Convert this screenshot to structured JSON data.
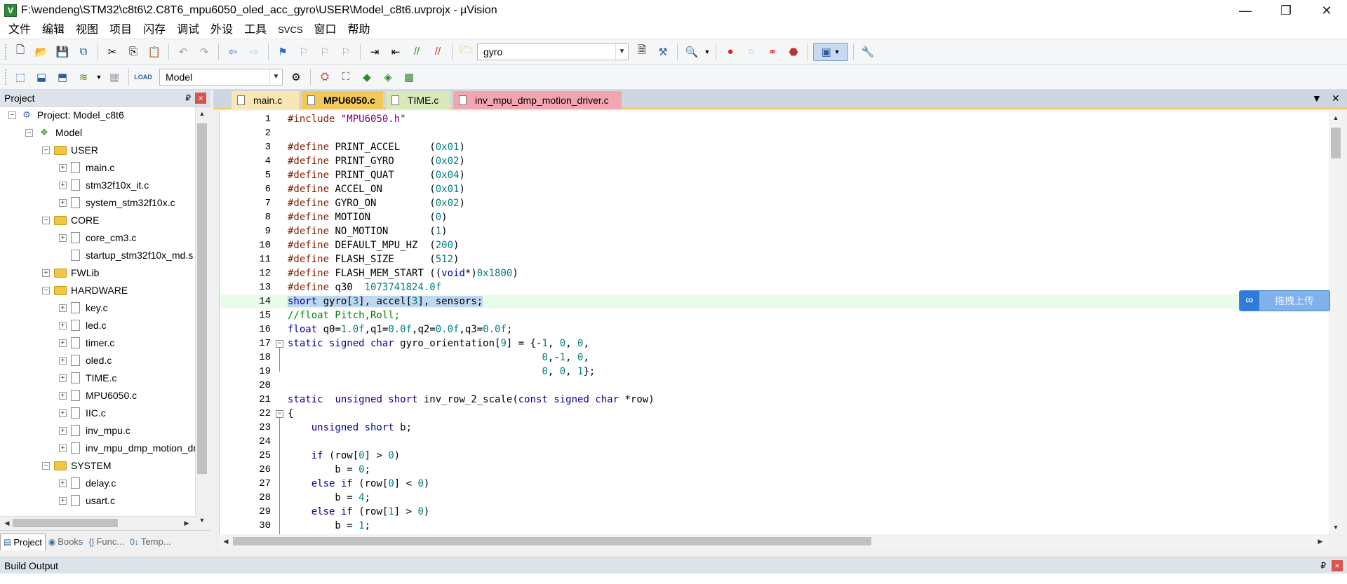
{
  "window": {
    "title": "F:\\wendeng\\STM32\\c8t6\\2.C8T6_mpu6050_oled_acc_gyro\\USER\\Model_c8t6.uvprojx - µVision",
    "app_icon_letter": "V",
    "minimize": "—",
    "maximize": "❐",
    "close": "✕"
  },
  "menu": [
    "文件",
    "编辑",
    "视图",
    "项目",
    "闪存",
    "调试",
    "外设",
    "工具",
    "SVCS",
    "窗口",
    "帮助"
  ],
  "toolbar": {
    "search_value": "gyro",
    "target_value": "Model"
  },
  "project_panel": {
    "title": "Project",
    "pin": "₽",
    "close": "×",
    "tree": [
      {
        "label": "Project: Model_c8t6",
        "level": 0,
        "kind": "project",
        "expander": "−"
      },
      {
        "label": "Model",
        "level": 1,
        "kind": "target",
        "expander": "−"
      },
      {
        "label": "USER",
        "level": 2,
        "kind": "folder",
        "expander": "−"
      },
      {
        "label": "main.c",
        "level": 3,
        "kind": "file",
        "expander": "+"
      },
      {
        "label": "stm32f10x_it.c",
        "level": 3,
        "kind": "file",
        "expander": "+"
      },
      {
        "label": "system_stm32f10x.c",
        "level": 3,
        "kind": "file",
        "expander": "+"
      },
      {
        "label": "CORE",
        "level": 2,
        "kind": "folder",
        "expander": "−"
      },
      {
        "label": "core_cm3.c",
        "level": 3,
        "kind": "file",
        "expander": "+"
      },
      {
        "label": "startup_stm32f10x_md.s",
        "level": 3,
        "kind": "file",
        "expander": ""
      },
      {
        "label": "FWLib",
        "level": 2,
        "kind": "folder",
        "expander": "+"
      },
      {
        "label": "HARDWARE",
        "level": 2,
        "kind": "folder",
        "expander": "−"
      },
      {
        "label": "key.c",
        "level": 3,
        "kind": "file",
        "expander": "+"
      },
      {
        "label": "led.c",
        "level": 3,
        "kind": "file",
        "expander": "+"
      },
      {
        "label": "timer.c",
        "level": 3,
        "kind": "file",
        "expander": "+"
      },
      {
        "label": "oled.c",
        "level": 3,
        "kind": "file",
        "expander": "+"
      },
      {
        "label": "TIME.c",
        "level": 3,
        "kind": "file",
        "expander": "+"
      },
      {
        "label": "MPU6050.c",
        "level": 3,
        "kind": "file",
        "expander": "+"
      },
      {
        "label": "IIC.c",
        "level": 3,
        "kind": "file",
        "expander": "+"
      },
      {
        "label": "inv_mpu.c",
        "level": 3,
        "kind": "file",
        "expander": "+"
      },
      {
        "label": "inv_mpu_dmp_motion_driver.c",
        "level": 3,
        "kind": "file",
        "expander": "+"
      },
      {
        "label": "SYSTEM",
        "level": 2,
        "kind": "folder",
        "expander": "−"
      },
      {
        "label": "delay.c",
        "level": 3,
        "kind": "file",
        "expander": "+"
      },
      {
        "label": "usart.c",
        "level": 3,
        "kind": "file",
        "expander": "+"
      }
    ],
    "tabs": [
      {
        "label": "Project",
        "icon": "▤",
        "active": true
      },
      {
        "label": "Books",
        "icon": "◉",
        "active": false
      },
      {
        "label": "Func...",
        "icon": "{}",
        "active": false
      },
      {
        "label": "Temp...",
        "icon": "0↓",
        "active": false
      }
    ]
  },
  "editor": {
    "tabs": [
      {
        "label": "main.c",
        "color": "#f7e7b4",
        "active": false
      },
      {
        "label": "MPU6050.c",
        "color": "#f3c85a",
        "active": true
      },
      {
        "label": "TIME.c",
        "color": "#d8e8b8",
        "active": false
      },
      {
        "label": "inv_mpu_dmp_motion_driver.c",
        "color": "#f3a6b0",
        "active": false
      }
    ],
    "strip_menu": "▼",
    "strip_close": "✕",
    "lines": [
      {
        "n": "1",
        "html": "<span class=\"pp\">#include</span> <span class=\"str\">\"MPU6050.h\"</span>"
      },
      {
        "n": "2",
        "html": ""
      },
      {
        "n": "3",
        "html": "<span class=\"pp\">#define</span> PRINT_ACCEL     (<span class=\"num\">0x01</span>)"
      },
      {
        "n": "4",
        "html": "<span class=\"pp\">#define</span> PRINT_GYRO      (<span class=\"num\">0x02</span>)"
      },
      {
        "n": "5",
        "html": "<span class=\"pp\">#define</span> PRINT_QUAT      (<span class=\"num\">0x04</span>)"
      },
      {
        "n": "6",
        "html": "<span class=\"pp\">#define</span> ACCEL_ON        (<span class=\"num\">0x01</span>)"
      },
      {
        "n": "7",
        "html": "<span class=\"pp\">#define</span> GYRO_ON         (<span class=\"num\">0x02</span>)"
      },
      {
        "n": "8",
        "html": "<span class=\"pp\">#define</span> MOTION          (<span class=\"num\">0</span>)"
      },
      {
        "n": "9",
        "html": "<span class=\"pp\">#define</span> NO_MOTION       (<span class=\"num\">1</span>)"
      },
      {
        "n": "10",
        "html": "<span class=\"pp\">#define</span> DEFAULT_MPU_HZ  (<span class=\"num\">200</span>)"
      },
      {
        "n": "11",
        "html": "<span class=\"pp\">#define</span> FLASH_SIZE      (<span class=\"num\">512</span>)"
      },
      {
        "n": "12",
        "html": "<span class=\"pp\">#define</span> FLASH_MEM_START ((<span class=\"kw\">void</span>*)<span class=\"num\">0x1800</span>)"
      },
      {
        "n": "13",
        "html": "<span class=\"pp\">#define</span> q30  <span class=\"num\">1073741824.0f</span>"
      },
      {
        "n": "14",
        "html": "<span class=\"sel\"><span class=\"kw\">short</span> gyro[<span class=\"num\">3</span>], accel[<span class=\"num\">3</span>], sensors;</span>",
        "current": true
      },
      {
        "n": "15",
        "html": "<span class=\"cmt\">//float Pitch,Roll;</span>"
      },
      {
        "n": "16",
        "html": "<span class=\"kw\">float</span> q0=<span class=\"num\">1.0f</span>,q1=<span class=\"num\">0.0f</span>,q2=<span class=\"num\">0.0f</span>,q3=<span class=\"num\">0.0f</span>;"
      },
      {
        "n": "17",
        "html": "<span class=\"kw\">static signed char</span> gyro_orientation[<span class=\"num\">9</span>] = {-<span class=\"num\">1</span>, <span class=\"num\">0</span>, <span class=\"num\">0</span>,",
        "fold": "−"
      },
      {
        "n": "18",
        "html": "                                           <span class=\"num\">0</span>,-<span class=\"num\">1</span>, <span class=\"num\">0</span>,"
      },
      {
        "n": "19",
        "html": "                                           <span class=\"num\">0</span>, <span class=\"num\">0</span>, <span class=\"num\">1</span>};"
      },
      {
        "n": "20",
        "html": ""
      },
      {
        "n": "21",
        "html": "<span class=\"kw\">static</span>  <span class=\"kw\">unsigned short</span> inv_row_2_scale(<span class=\"kw\">const signed char</span> *row)"
      },
      {
        "n": "22",
        "html": "{",
        "fold": "−"
      },
      {
        "n": "23",
        "html": "    <span class=\"kw\">unsigned short</span> b;"
      },
      {
        "n": "24",
        "html": ""
      },
      {
        "n": "25",
        "html": "    <span class=\"kw\">if</span> (row[<span class=\"num\">0</span>] &gt; <span class=\"num\">0</span>)"
      },
      {
        "n": "26",
        "html": "        b = <span class=\"num\">0</span>;"
      },
      {
        "n": "27",
        "html": "    <span class=\"kw\">else if</span> (row[<span class=\"num\">0</span>] &lt; <span class=\"num\">0</span>)"
      },
      {
        "n": "28",
        "html": "        b = <span class=\"num\">4</span>;"
      },
      {
        "n": "29",
        "html": "    <span class=\"kw\">else if</span> (row[<span class=\"num\">1</span>] &gt; <span class=\"num\">0</span>)"
      },
      {
        "n": "30",
        "html": "        b = <span class=\"num\">1</span>;"
      }
    ]
  },
  "cloud_widget": {
    "icon": "∞",
    "label": "拖拽上传"
  },
  "build_output": {
    "title": "Build Output",
    "pin": "₽",
    "close": "×"
  },
  "colors": {
    "accent_tab": "#f3c85a",
    "selection": "#bfd7f0",
    "current_line": "#e9fbe9"
  }
}
